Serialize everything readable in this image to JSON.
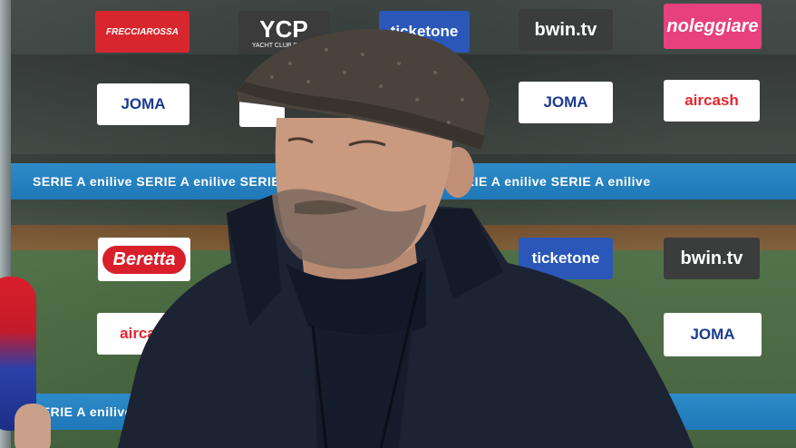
{
  "scene": {
    "description_labels": [],
    "banners": [
      {
        "text": "SERIE A enilive   SERIE A enilive   SERIE A enilive   SERIE A enilive   SERIE A enilive   SERIE A enilive"
      },
      {
        "text": "SERIE A enilive   SERIE A enilive   SERIE A enilive   SERIE A enilive   SERIE A enilive"
      }
    ],
    "sponsors": {
      "frecciarossa": "FRECCIAROSSA",
      "ycp": "YCP",
      "ycp_sub": "YACHT CLUB PORTO",
      "ticketone_top": "ticketone",
      "bwin_top": "bwin.tv",
      "noleggiare": "noleggiare",
      "joma_1": "JOMA",
      "joma_2": "JOMA",
      "aircash_1": "aircash",
      "beretta": "Beretta",
      "ticketone_mid": "ticketone",
      "bwin_mid": "bwin.tv",
      "aircash_2": "airca",
      "joma_3": "JOMA"
    }
  },
  "colors": {
    "serie_a_blue": "#1f78b8",
    "frecciarossa_red": "#d7262e",
    "ticketone_blue": "#2a57b8",
    "noleggiare_pink": "#e6417c",
    "jacket_navy": "#1c2333"
  }
}
